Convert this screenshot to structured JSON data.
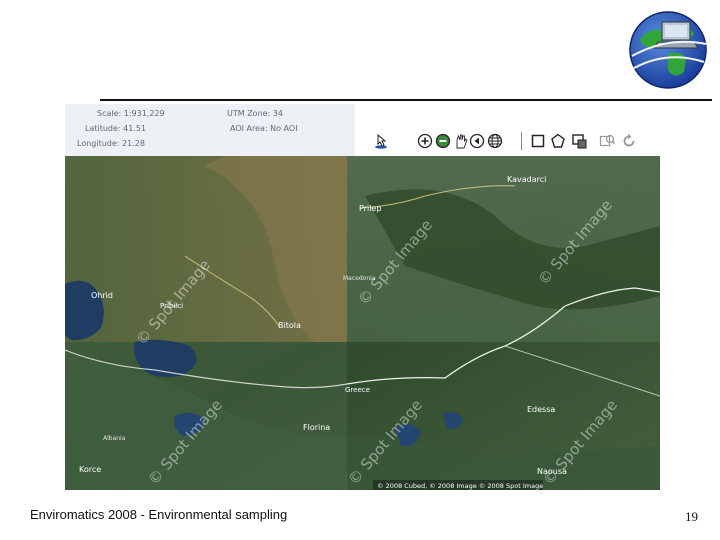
{
  "info": {
    "scale": "Scale: 1:931,229",
    "utm": "UTM Zone: 34",
    "latitude": "Latitude: 41.51",
    "aoi": "AOI Area: No AOI",
    "longitude": "Longitude: 21.28"
  },
  "toolbar": {
    "tools": [
      "pointer-icon",
      "zoom-in-icon",
      "zoom-out-icon",
      "pan-icon",
      "back-icon",
      "globe-icon",
      "rectangle-select-icon",
      "polygon-select-icon",
      "layer-icon",
      "zoom-window-icon",
      "refresh-icon"
    ]
  },
  "map": {
    "places": [
      "Kavadarci",
      "Prilep",
      "Ohrid",
      "Pribilci",
      "Bitola",
      "Florina",
      "Edessa",
      "Naousa",
      "Korce",
      "Greece",
      "Albania",
      "Macedonia"
    ],
    "watermark": "© Spot Image",
    "copyright": "© 2008 Cubed, © 2008 Image © 2008 Spot Image"
  },
  "footer": {
    "caption": "Enviromatics 2008 - Environmental sampling",
    "page": "19"
  },
  "colors": {
    "rule": "#111111",
    "forest": "#2f4a2c",
    "lake": "#1f3d63",
    "road": "#f2f2f2"
  }
}
